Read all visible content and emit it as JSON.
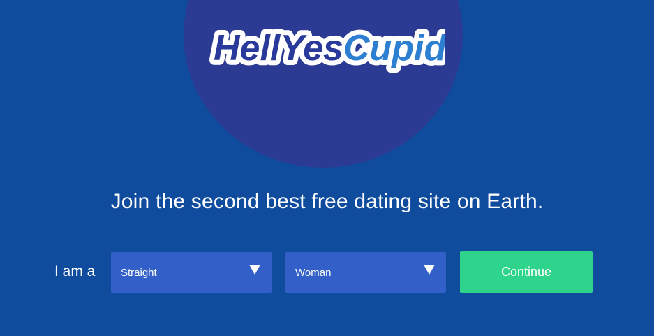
{
  "brand": {
    "logo_text_part1": "HellYes",
    "logo_text_part2": "Cupid",
    "logo_dark_color": "#2a3a9a",
    "logo_light_color": "#2d7fd1"
  },
  "hero": {
    "tagline": "Join the second best free dating site on Earth."
  },
  "signup": {
    "iam_label": "I am a",
    "orientation": {
      "selected": "Straight",
      "icon": "triangle-down-icon"
    },
    "gender": {
      "selected": "Woman",
      "icon": "triangle-down-icon"
    },
    "continue_label": "Continue"
  },
  "colors": {
    "background": "#0f4c9e",
    "circle": "#2b3a93",
    "select_bg": "#3260c8",
    "continue_bg": "#2ed38c"
  }
}
